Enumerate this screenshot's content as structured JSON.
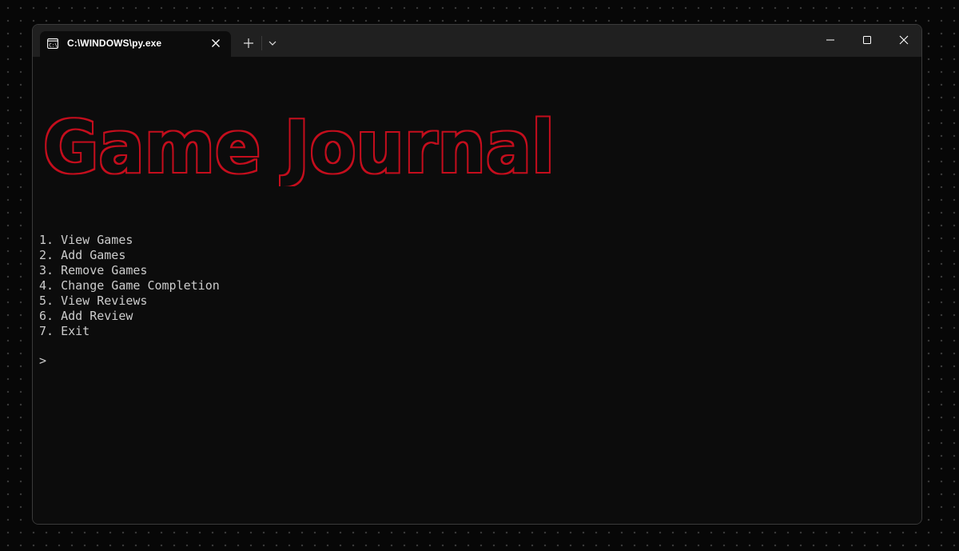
{
  "window": {
    "tab_title": "C:\\WINDOWS\\py.exe",
    "tab_icon": "console-icon",
    "controls": [
      "minimize-icon",
      "maximize-icon",
      "close-icon"
    ]
  },
  "console": {
    "banner_text": "Game Journal",
    "banner_color": "#c50f1f",
    "text_color": "#cccccc",
    "background": "#0c0c0c",
    "menu_items": [
      "1. View Games",
      "2. Add Games",
      "3. Remove Games",
      "4. Change Game Completion",
      "5. View Reviews",
      "6. Add Review",
      "7. Exit"
    ],
    "prompt": ">"
  }
}
